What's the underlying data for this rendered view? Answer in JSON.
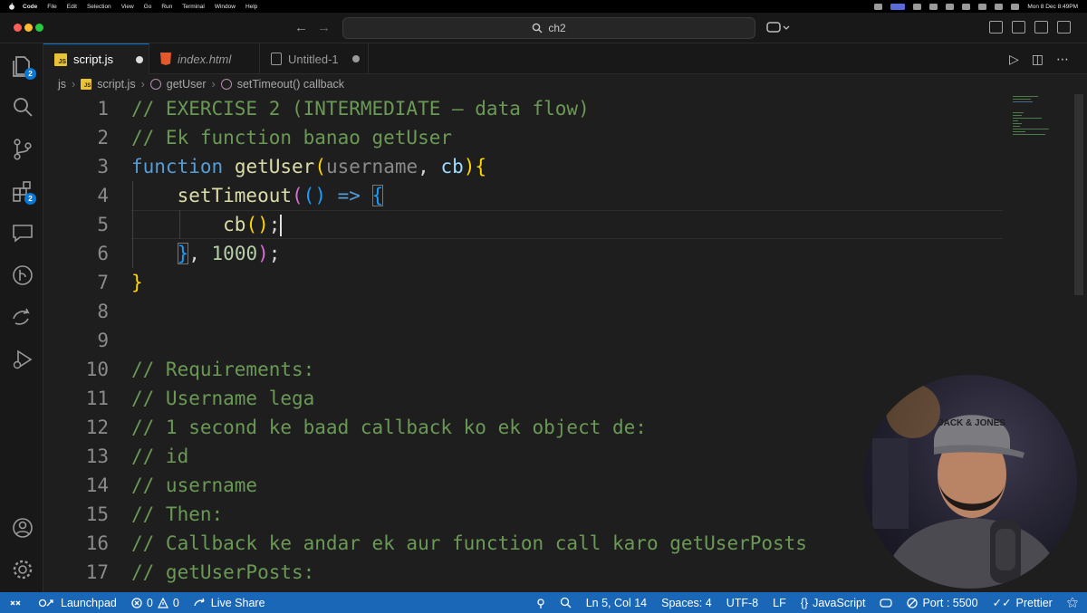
{
  "menubar": {
    "app": "Code",
    "items": [
      "File",
      "Edit",
      "Selection",
      "View",
      "Go",
      "Run",
      "Terminal",
      "Window",
      "Help"
    ],
    "clock": "Mon 8 Dec 8:49PM"
  },
  "titlebar": {
    "search_text": "ch2",
    "search_icon": "search-icon"
  },
  "activity_bar": {
    "explorer_badge": "2",
    "extensions_badge": "2"
  },
  "tabs": [
    {
      "label": "script.js",
      "type": "js",
      "active": true,
      "dirty": true
    },
    {
      "label": "index.html",
      "type": "html",
      "active": false,
      "dirty": false
    },
    {
      "label": "Untitled-1",
      "type": "untitled",
      "active": false,
      "dirty": true
    }
  ],
  "breadcrumb": {
    "folder": "js",
    "file": "script.js",
    "symbol1": "getUser",
    "symbol2": "setTimeout() callback"
  },
  "editor": {
    "lines": [
      {
        "n": "1",
        "text": "// EXERCISE 2 (INTERMEDIATE — data flow)"
      },
      {
        "n": "2",
        "text": "// Ek function banao getUser"
      },
      {
        "n": "3",
        "text": "function getUser(username, cb){"
      },
      {
        "n": "4",
        "text": "    setTimeout(() => {"
      },
      {
        "n": "5",
        "text": "        cb();"
      },
      {
        "n": "6",
        "text": "    }, 1000);"
      },
      {
        "n": "7",
        "text": "}"
      },
      {
        "n": "8",
        "text": ""
      },
      {
        "n": "9",
        "text": ""
      },
      {
        "n": "10",
        "text": "// Requirements:"
      },
      {
        "n": "11",
        "text": "// Username lega"
      },
      {
        "n": "12",
        "text": "// 1 second ke baad callback ko ek object de:"
      },
      {
        "n": "13",
        "text": "// id"
      },
      {
        "n": "14",
        "text": "// username"
      },
      {
        "n": "15",
        "text": "// Then:"
      },
      {
        "n": "16",
        "text": "// Callback ke andar ek aur function call karo getUserPosts"
      },
      {
        "n": "17",
        "text": "// getUserPosts:"
      }
    ],
    "tokens": {
      "l3": [
        "function",
        "getUser",
        "(",
        "username",
        ", ",
        "cb",
        ")",
        "{"
      ],
      "l4": [
        "setTimeout",
        "(",
        "()",
        " => ",
        "{"
      ],
      "l5": [
        "cb",
        "()",
        ";"
      ],
      "l6": [
        "}",
        ", ",
        "1000",
        ")",
        ";"
      ],
      "l7": [
        "}"
      ]
    }
  },
  "webcam": {
    "cap_text": "JACK & JONES"
  },
  "statusbar": {
    "launchpad": "Launchpad",
    "errors": "0",
    "warnings": "0",
    "live_share": "Live Share",
    "position": "Ln 5, Col 14",
    "spaces": "Spaces: 4",
    "encoding": "UTF-8",
    "eol": "LF",
    "language": "JavaScript",
    "port": "Port : 5500",
    "prettier": "Prettier"
  },
  "colors": {
    "accent": "#0a78d6",
    "statusbar": "#1a67b8",
    "comment": "#6a9955",
    "keyword": "#569cd6"
  }
}
